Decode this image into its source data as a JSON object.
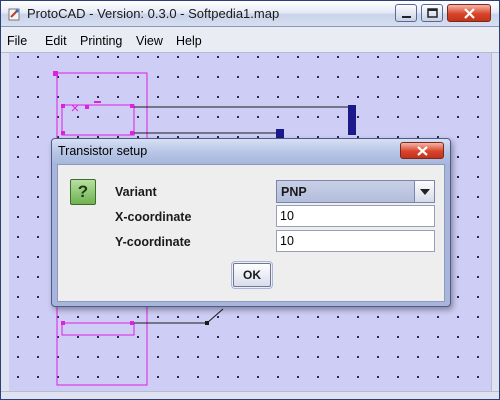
{
  "window": {
    "title": "ProtoCAD - Version: 0.3.0 - Softpedia1.map",
    "icon": "app-icon",
    "controls": [
      "minimize-icon",
      "maximize-icon",
      "close-icon"
    ]
  },
  "menubar": {
    "items": [
      "File",
      "Edit",
      "Printing",
      "View",
      "Help"
    ]
  },
  "dialog": {
    "title": "Transistor setup",
    "icon": "question-icon",
    "icon_text": "?",
    "fields": {
      "variant_label": "Variant",
      "variant_value": "PNP",
      "x_label": "X-coordinate",
      "x_value": "10",
      "y_label": "Y-coordinate",
      "y_value": "10"
    },
    "ok_label": "OK"
  },
  "colors": {
    "canvas_bg": "#cdcdf5",
    "selection": "#e020e0",
    "component": "#1a1a8a"
  }
}
